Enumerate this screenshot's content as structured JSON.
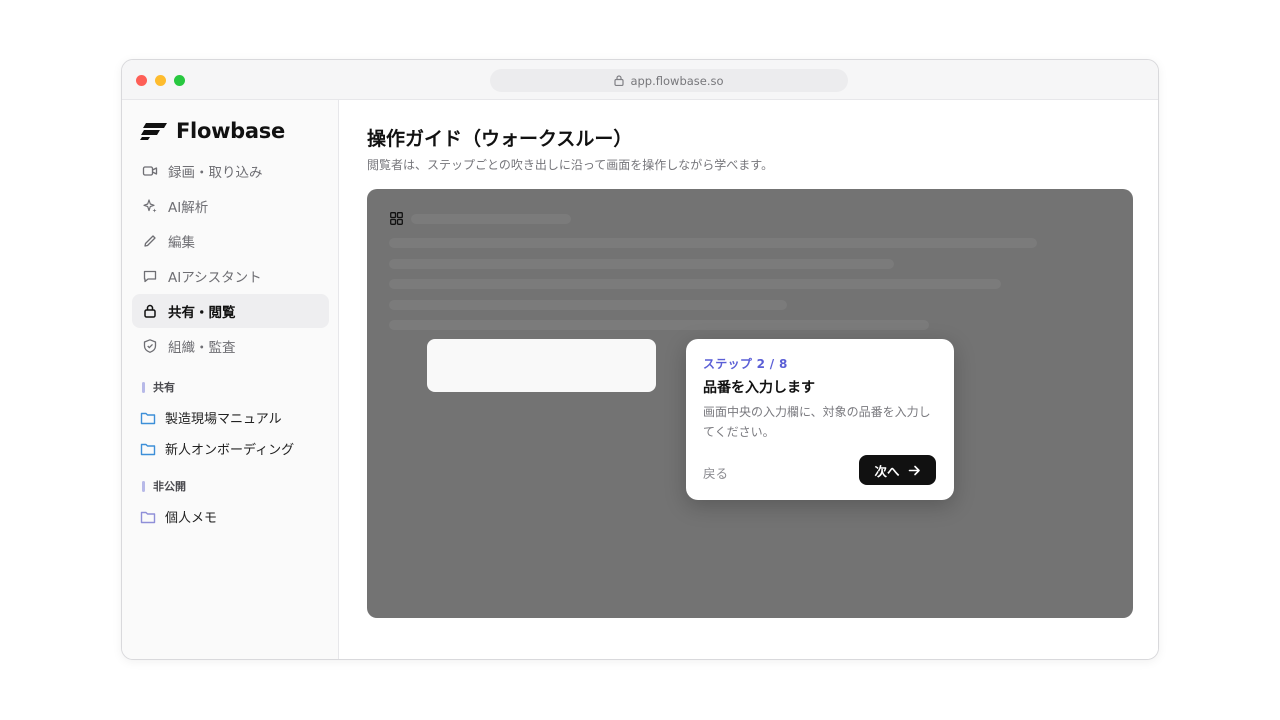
{
  "browser": {
    "url": "app.flowbase.so"
  },
  "brand": {
    "name": "Flowbase"
  },
  "sidebar": {
    "nav": [
      {
        "label": "録画・取り込み",
        "icon": "video-icon"
      },
      {
        "label": "AI解析",
        "icon": "sparkle-icon"
      },
      {
        "label": "編集",
        "icon": "pencil-icon"
      },
      {
        "label": "AIアシスタント",
        "icon": "chat-icon"
      },
      {
        "label": "共有・閲覧",
        "icon": "lock-icon",
        "active": true
      },
      {
        "label": "組織・監査",
        "icon": "shield-icon"
      }
    ],
    "sections": [
      {
        "label": "共有",
        "folders": [
          "製造現場マニュアル",
          "新人オンボーディング"
        ]
      },
      {
        "label": "非公開",
        "folders": [
          "個人メモ"
        ]
      }
    ]
  },
  "main": {
    "title": "操作ガイド（ウォークスルー）",
    "subtitle": "閲覧者は、ステップごとの吹き出しに沿って画面を操作しながら学べます。"
  },
  "tooltip": {
    "step": "ステップ 2 / 8",
    "title": "品番を入力します",
    "body": "画面中央の入力欄に、対象の品番を入力してください。",
    "back_label": "戻る",
    "next_label": "次へ"
  },
  "colors": {
    "accent": "#5b5fd6",
    "overlay": "#737373",
    "folder_shared": "#3d8fd8",
    "folder_private": "#8f8fd8",
    "section_bar": "#b7b9e8"
  }
}
